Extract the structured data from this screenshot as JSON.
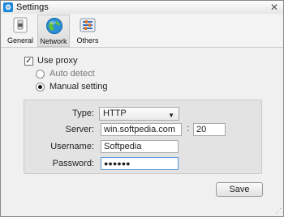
{
  "window": {
    "title": "Settings",
    "app_icon": "gear-icon"
  },
  "toolbar": {
    "items": [
      {
        "label": "General",
        "icon": "switch-icon",
        "active": false
      },
      {
        "label": "Network",
        "icon": "globe-icon",
        "active": true
      },
      {
        "label": "Others",
        "icon": "sliders-icon",
        "active": false
      }
    ]
  },
  "proxy": {
    "use_proxy_label": "Use proxy",
    "use_proxy_checked": true,
    "auto_detect_label": "Auto detect",
    "manual_label": "Manual setting",
    "selected": "manual"
  },
  "form": {
    "type_label": "Type:",
    "type_value": "HTTP",
    "server_label": "Server:",
    "server_value": "win.softpedia.com",
    "port_separator": ":",
    "port_value": "20",
    "username_label": "Username:",
    "username_value": "Softpedia",
    "password_label": "Password:",
    "password_value": "●●●●●●"
  },
  "buttons": {
    "save_label": "Save"
  },
  "colors": {
    "accent": "#1a86d8",
    "focus_border": "#5a98d8"
  }
}
